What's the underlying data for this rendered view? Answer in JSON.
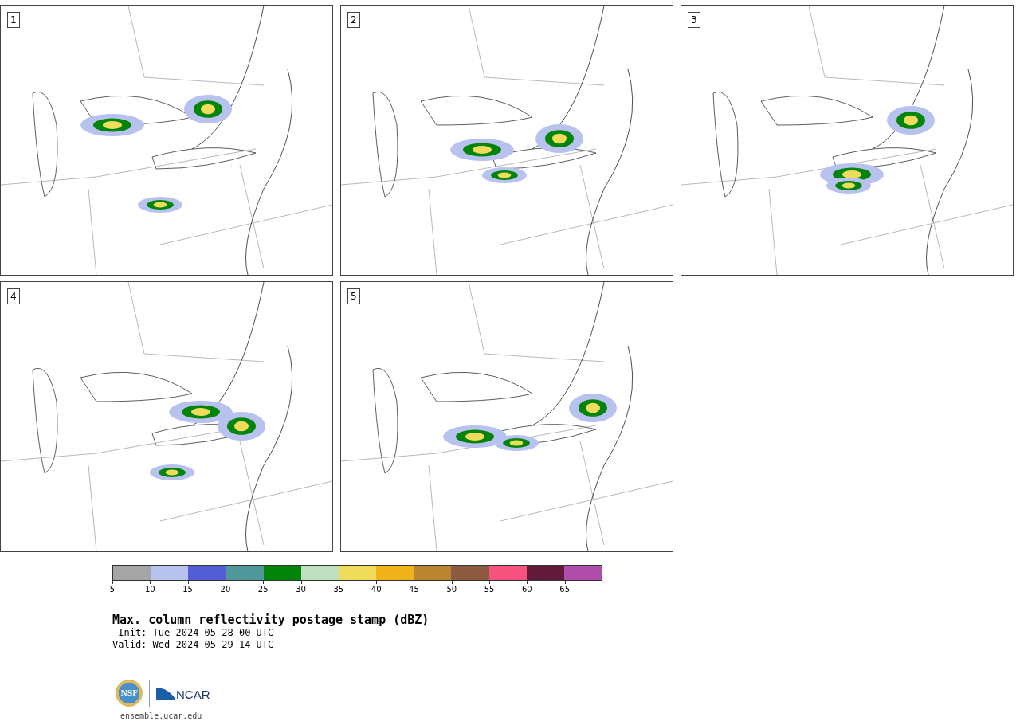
{
  "panels": [
    {
      "label": "1",
      "kind": "map-picture"
    },
    {
      "label": "2",
      "kind": "map-picture"
    },
    {
      "label": "3",
      "kind": "map-picture"
    },
    {
      "label": "4",
      "kind": "map-picture"
    },
    {
      "label": "5",
      "kind": "map-picture"
    }
  ],
  "colorbar": {
    "swatches": [
      {
        "color": "#a5a5a5"
      },
      {
        "color": "#b8c2ee"
      },
      {
        "color": "#535ed6"
      },
      {
        "color": "#4f9799"
      },
      {
        "color": "#00850a"
      },
      {
        "color": "#bedfc0"
      },
      {
        "color": "#efdc5a"
      },
      {
        "color": "#efb21a"
      },
      {
        "color": "#bb8431"
      },
      {
        "color": "#8b5a3f"
      },
      {
        "color": "#f6527f"
      },
      {
        "color": "#611a37"
      },
      {
        "color": "#b04ca9"
      }
    ],
    "ticks": [
      "5",
      "10",
      "15",
      "20",
      "25",
      "30",
      "35",
      "40",
      "45",
      "50",
      "55",
      "60",
      "65"
    ]
  },
  "title": "Max. column reflectivity postage stamp (dBZ)",
  "init": " Init: Tue 2024-05-28 00 UTC",
  "valid": "Valid: Wed 2024-05-29 14 UTC",
  "logos": {
    "left": "NSF",
    "right": "NCAR"
  },
  "url": "ensemble.ucar.edu"
}
